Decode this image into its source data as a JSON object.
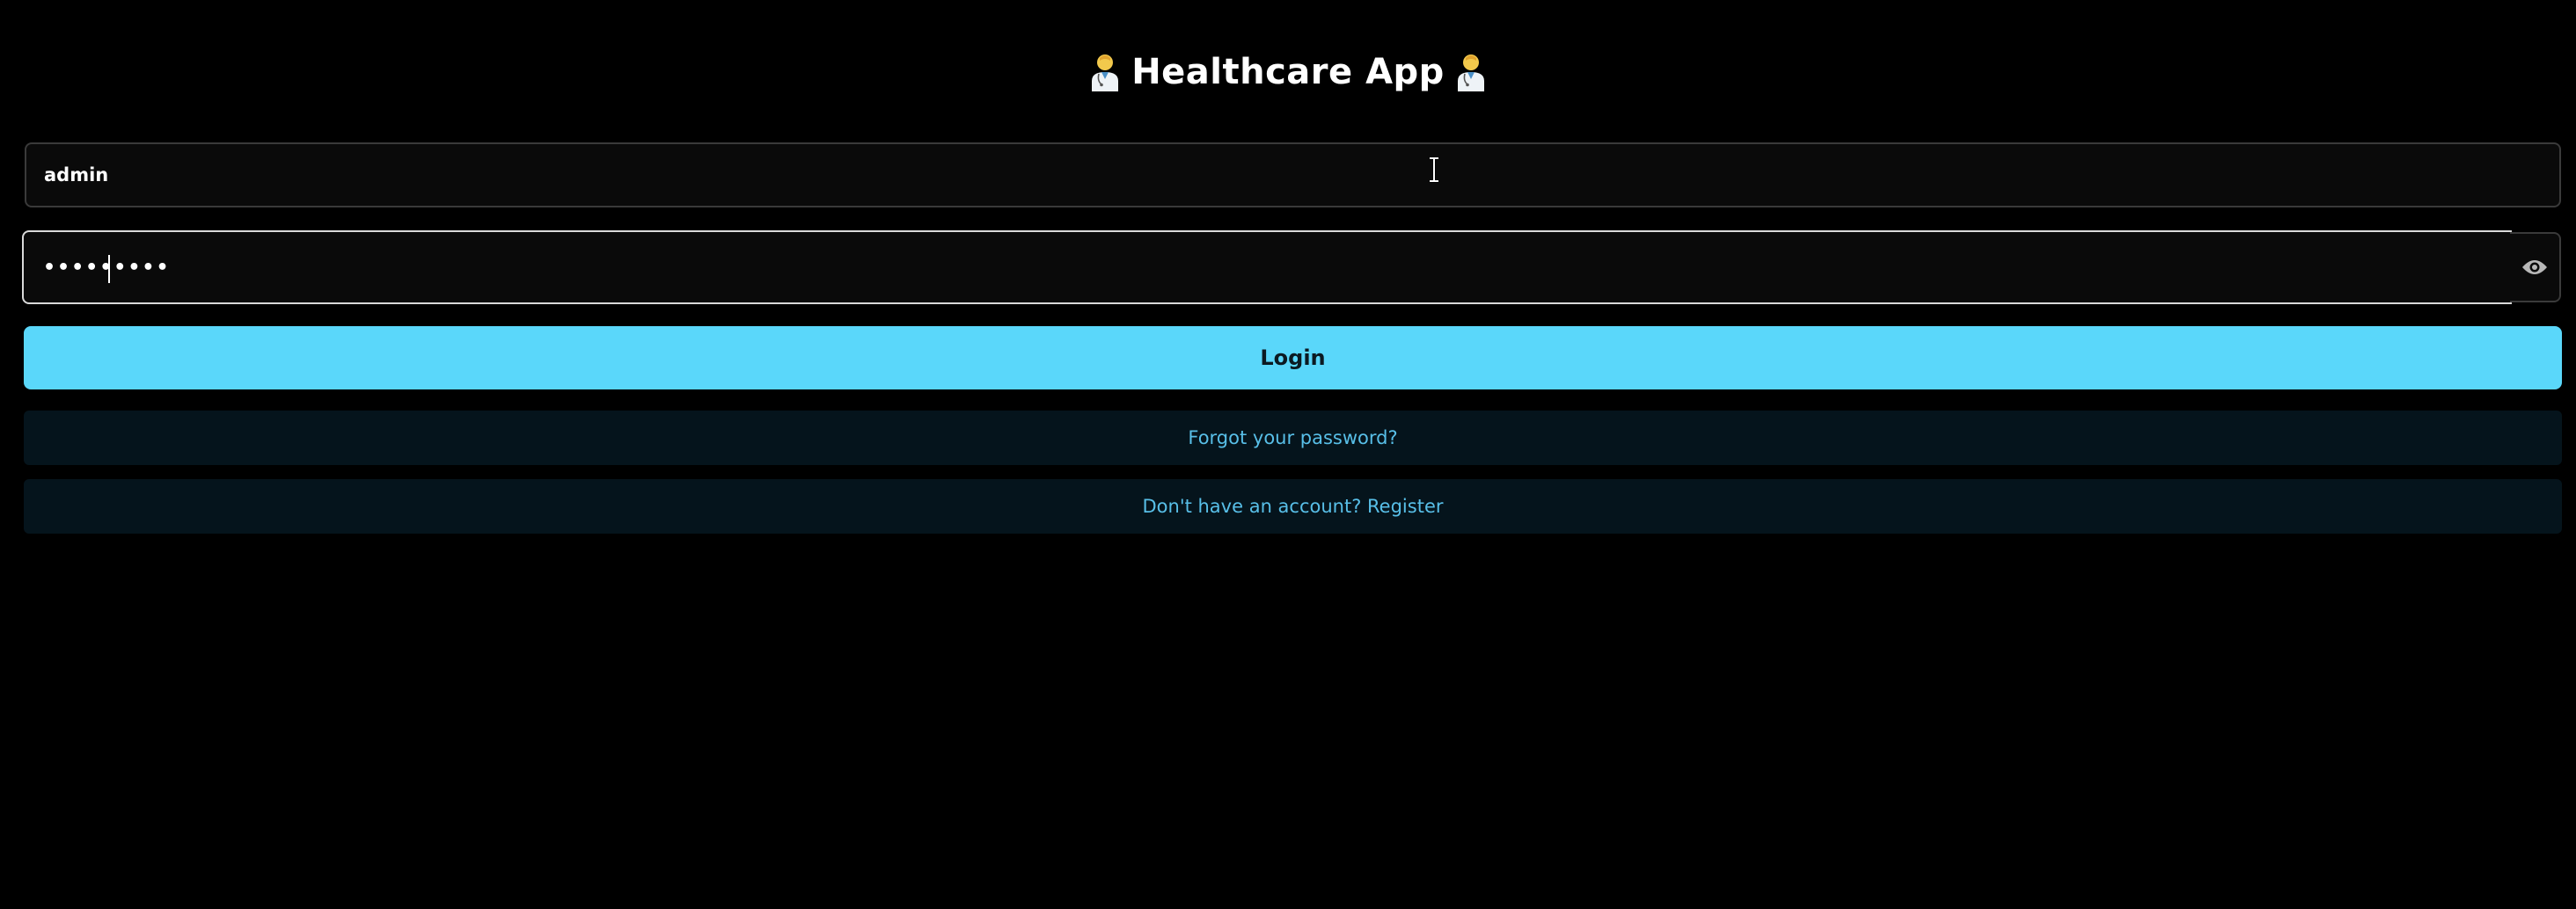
{
  "header": {
    "title": "Healthcare App",
    "left_icon": "doctor-icon",
    "right_icon": "doctor-icon"
  },
  "login_form": {
    "username_value": "admin",
    "password_value": "•••••••••",
    "password_toggle_icon": "eye-icon",
    "login_label": "Login",
    "forgot_label": "Forgot your password?",
    "register_label": "Don't have an account? Register"
  },
  "colors": {
    "background": "#000000",
    "accent": "#5ad7fa",
    "link": "#58bfe8",
    "field_background": "#0a0a0a"
  }
}
